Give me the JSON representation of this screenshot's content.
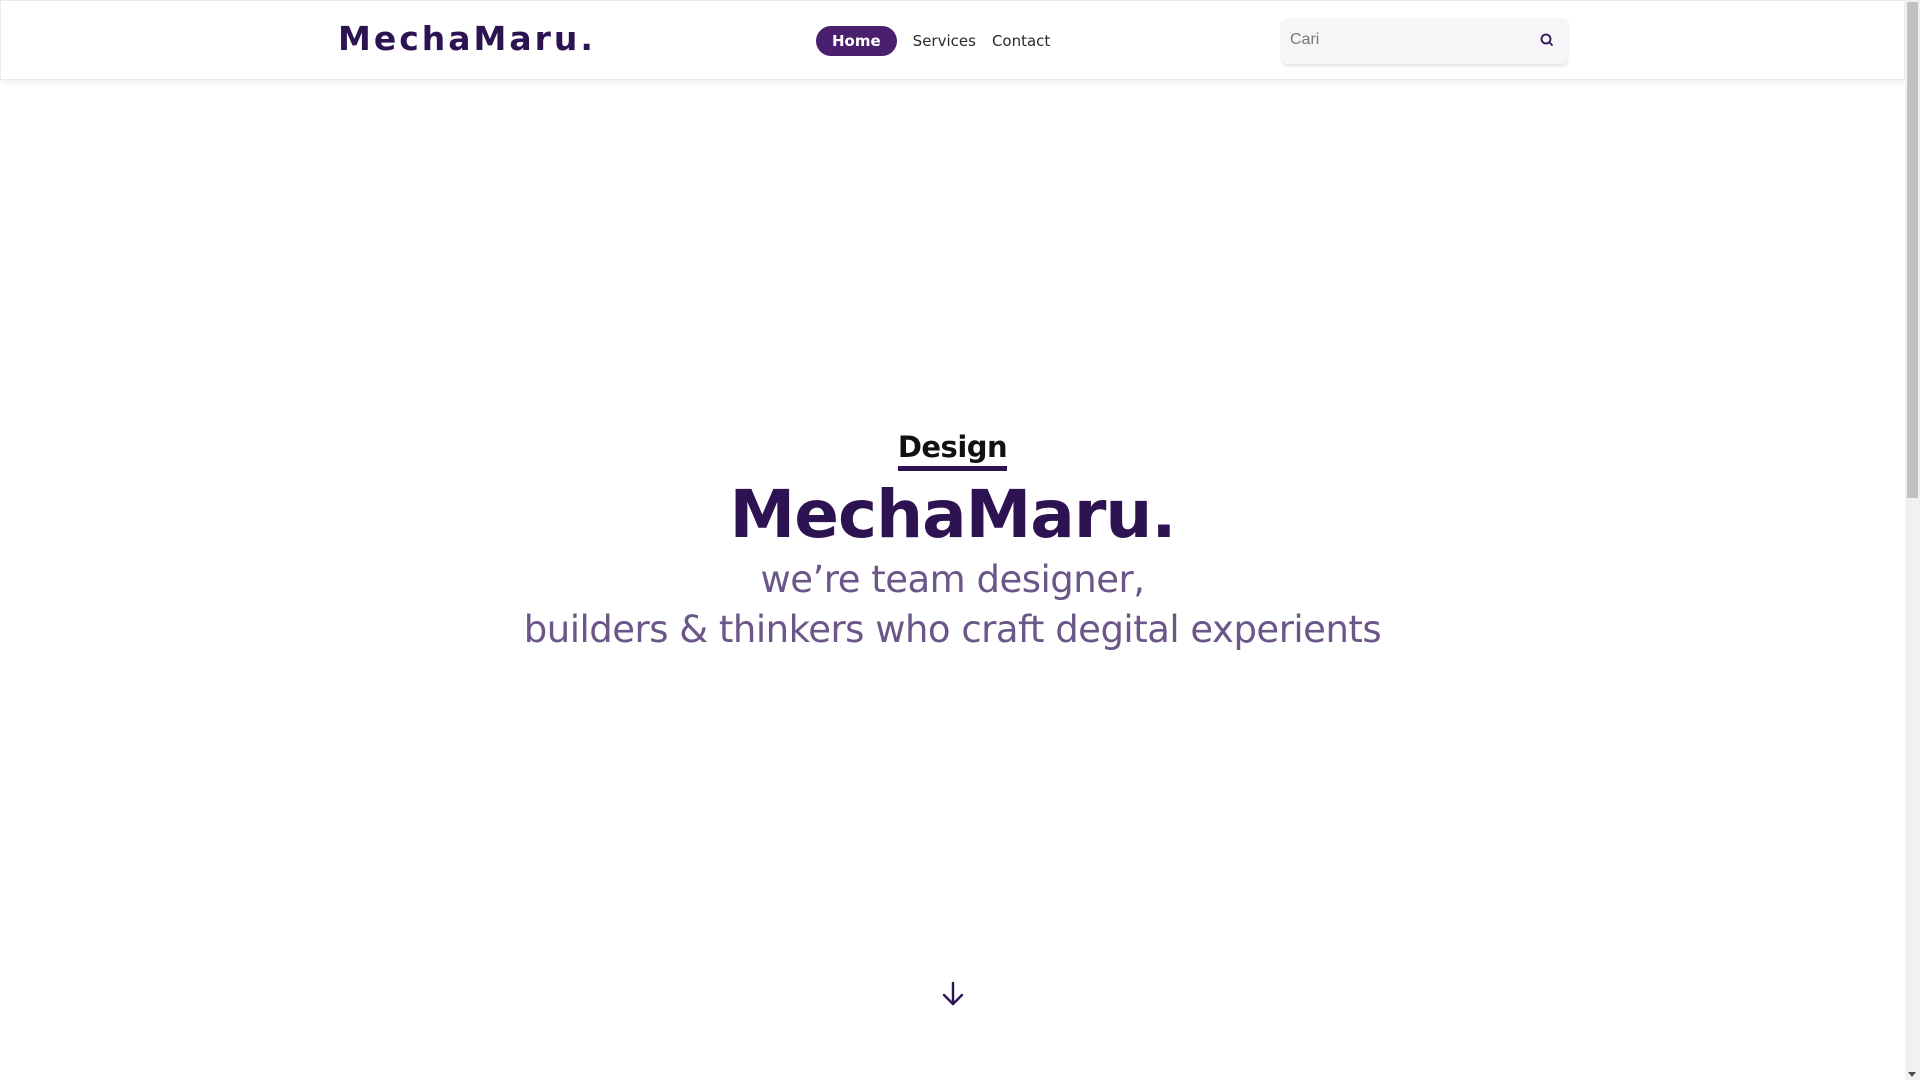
{
  "navbar": {
    "brand": "MechaMaru.",
    "links": [
      {
        "label": "Home",
        "active": true
      },
      {
        "label": "Services",
        "active": false
      },
      {
        "label": "Contact",
        "active": false
      }
    ],
    "search": {
      "placeholder": "Cari",
      "value": "",
      "icon": "search-icon"
    }
  },
  "hero": {
    "eyebrow": "Design",
    "title": "MechaMaru.",
    "subtitle_line1": "we’re team designer,",
    "subtitle_line2": "builders & thinkers who craft degital experients",
    "scroll_icon": "arrow-down-icon"
  },
  "colors": {
    "brand": "#2e1352",
    "active_nav_bg": "#4a1f6e",
    "subtitle": "#6a5687"
  }
}
